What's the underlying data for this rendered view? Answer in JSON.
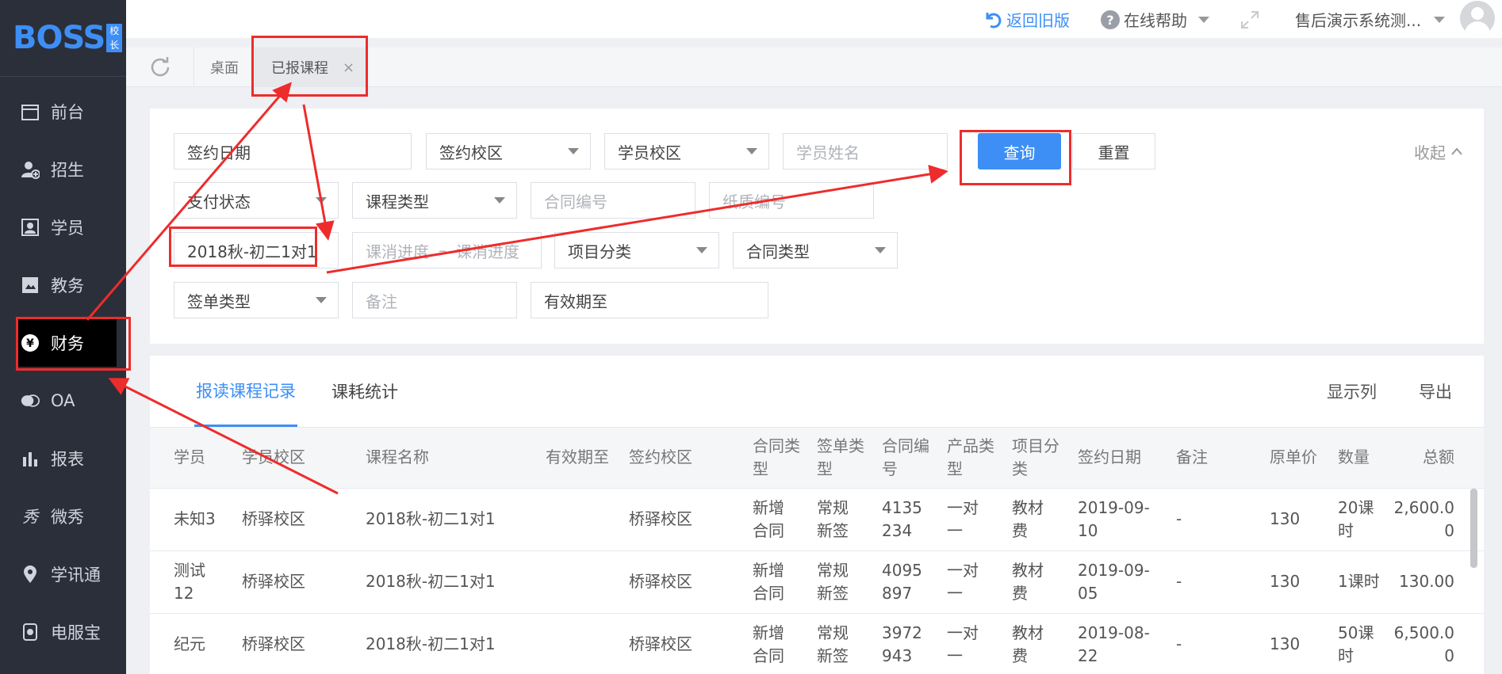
{
  "app": {
    "logo_text": "BOSS",
    "logo_badge": "校长"
  },
  "sidebar": {
    "items": [
      {
        "label": "前台",
        "icon": "calendar-icon"
      },
      {
        "label": "招生",
        "icon": "add-user-icon"
      },
      {
        "label": "学员",
        "icon": "id-card-icon"
      },
      {
        "label": "教务",
        "icon": "book-icon"
      },
      {
        "label": "财务",
        "icon": "yen-icon",
        "active": true
      },
      {
        "label": "OA",
        "icon": "chat-icon"
      },
      {
        "label": "报表",
        "icon": "bar-chart-icon"
      },
      {
        "label": "微秀",
        "icon": "xiu-icon"
      },
      {
        "label": "学讯通",
        "icon": "location-icon"
      },
      {
        "label": "电服宝",
        "icon": "phone-icon"
      }
    ]
  },
  "topbar": {
    "back_old": "返回旧版",
    "help": "在线帮助",
    "account": "售后演示系统测..."
  },
  "tabs": {
    "desk": "桌面",
    "current": "已报课程"
  },
  "filters": {
    "sign_date": "签约日期",
    "sign_campus": "签约校区",
    "student_campus": "学员校区",
    "student_name_ph": "学员姓名",
    "query_btn": "查询",
    "reset_btn": "重置",
    "collapse": "收起",
    "pay_status": "支付状态",
    "course_type": "课程类型",
    "contract_no_ph": "合同编号",
    "paper_no_ph": "纸质编号",
    "course_name": "2018秋-初二1对1",
    "progress_from_ph": "课消进度",
    "progress_sep": "–",
    "progress_to_ph": "课消进度",
    "project_cat": "项目分类",
    "contract_type": "合同类型",
    "sign_type": "签单类型",
    "remark_ph": "备注",
    "valid_until": "有效期至"
  },
  "table": {
    "tabs": [
      "报读课程记录",
      "课耗统计"
    ],
    "show_columns": "显示列",
    "export": "导出",
    "headers": [
      "学员",
      "学员校区",
      "课程名称",
      "有效期至",
      "签约校区",
      "合同类\n型",
      "签单类\n型",
      "合同编\n号",
      "产品类\n型",
      "项目分\n类",
      "签约日期",
      "备注",
      "原单价",
      "数量",
      "总额"
    ],
    "rows": [
      [
        "未知3",
        "桥驿校区",
        "2018秋-初二1对1",
        "",
        "桥驿校区",
        "新增\n合同",
        "常规\n新签",
        "4135\n234",
        "一对\n一",
        "教材\n费",
        "2019-09-\n10",
        "-",
        "130",
        "20课\n时",
        "2,600.0\n0"
      ],
      [
        "测试\n12",
        "桥驿校区",
        "2018秋-初二1对1",
        "",
        "桥驿校区",
        "新增\n合同",
        "常规\n新签",
        "4095\n897",
        "一对\n一",
        "教材\n费",
        "2019-09-\n05",
        "-",
        "130",
        "1课时",
        "130.00"
      ],
      [
        "纪元",
        "桥驿校区",
        "2018秋-初二1对1",
        "",
        "桥驿校区",
        "新增\n合同",
        "常规\n新签",
        "3972\n943",
        "一对\n一",
        "教材\n费",
        "2019-08-\n22",
        "-",
        "130",
        "50课\n时",
        "6,500.0\n0"
      ]
    ]
  },
  "colors": {
    "accent": "#3d8ff5",
    "annotation": "#ee2c2c",
    "sidebar_bg": "#2b2f3a"
  }
}
